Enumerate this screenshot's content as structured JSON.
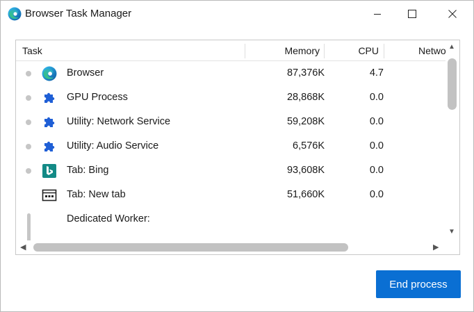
{
  "window": {
    "title": "Browser Task Manager",
    "minimize_glyph": "—",
    "maximize_glyph": "☐",
    "close_glyph": "✕"
  },
  "table": {
    "columns": [
      "Task",
      "Memory",
      "CPU",
      "Netwo"
    ],
    "rows": [
      {
        "name": "Browser",
        "memory": "87,376K",
        "cpu": "4.7",
        "icon": "edge-icon"
      },
      {
        "name": "GPU Process",
        "memory": "28,868K",
        "cpu": "0.0",
        "icon": "puzzle-icon"
      },
      {
        "name": "Utility: Network Service",
        "memory": "59,208K",
        "cpu": "0.0",
        "icon": "puzzle-icon"
      },
      {
        "name": "Utility: Audio Service",
        "memory": "6,576K",
        "cpu": "0.0",
        "icon": "puzzle-icon"
      },
      {
        "name": "Tab: Bing",
        "memory": "93,608K",
        "cpu": "0.0",
        "icon": "bing-icon"
      },
      {
        "name": "Tab: New tab",
        "memory": "51,660K",
        "cpu": "0.0",
        "icon": "newtab-icon"
      },
      {
        "name": "Dedicated Worker:",
        "memory": "",
        "cpu": "",
        "icon": ""
      }
    ]
  },
  "actions": {
    "end_process_label": "End process"
  },
  "colors": {
    "accent": "#0a6fd3",
    "puzzle": "#1f5fd6",
    "bing": "#138a86"
  }
}
